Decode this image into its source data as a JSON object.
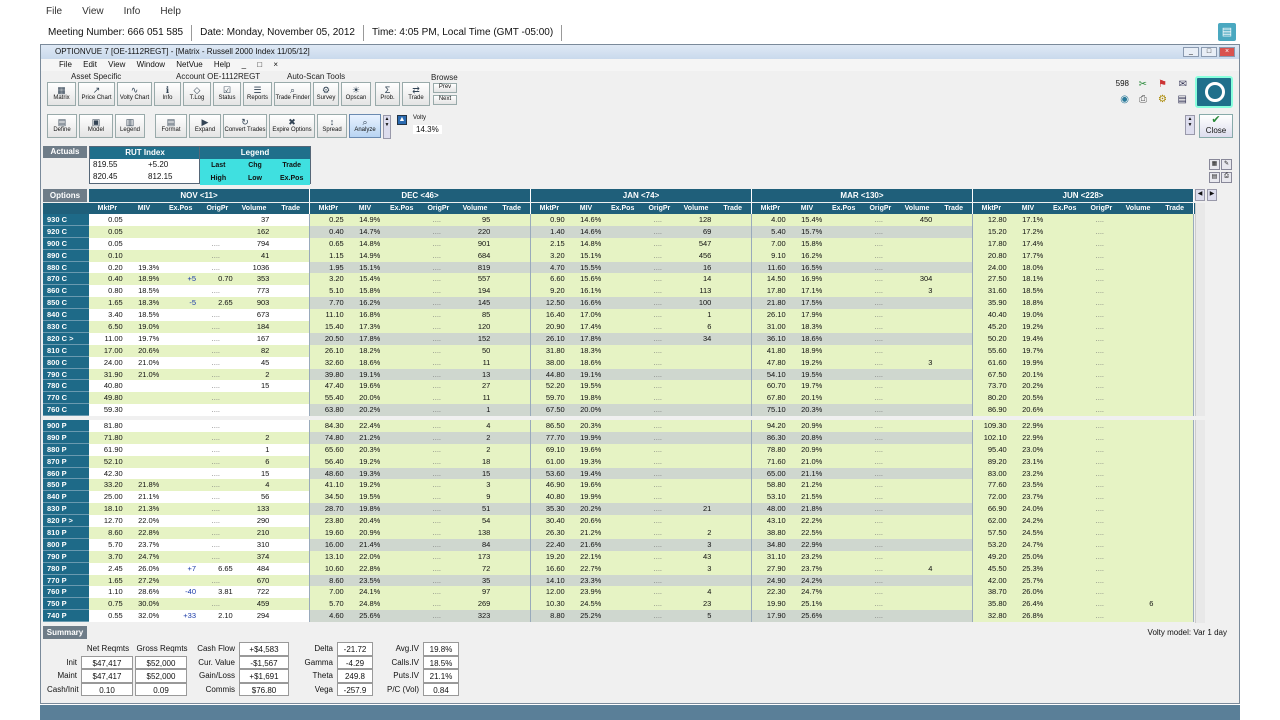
{
  "outer": {
    "menu": [
      "File",
      "View",
      "Info",
      "Help"
    ],
    "meeting": "Meeting Number: 666 051 585",
    "date": "Date: Monday, November 05, 2012",
    "time": "Time: 4:05 PM, Local Time (GMT -05:00)"
  },
  "window": {
    "title": "OPTIONVUE 7  [OE-1112REGT] - [Matrix - Russell 2000 Index 11/05/12]",
    "menu": [
      "File",
      "Edit",
      "View",
      "Window",
      "NetVue",
      "Help",
      "_",
      "□",
      "×"
    ]
  },
  "toolbar": {
    "asset_specific": "Asset Specific",
    "account": "Account OE-1112REGT",
    "auto_scan": "Auto-Scan Tools",
    "browse": "Browse",
    "row1": [
      "Matrix",
      "Price Chart",
      "Volty Chart",
      "Info",
      "T.Log",
      "Status",
      "Reports",
      "Trade Finder",
      "Survey",
      "Opscan",
      "Prob.",
      "Trade"
    ],
    "prev": "Prev",
    "next": "Next",
    "row2": [
      "Define",
      "Model",
      "Legend",
      "Format",
      "Expand",
      "Convert Trades",
      "Expire Options",
      "Spread",
      "Analyze"
    ],
    "volty_label": "Volty",
    "volty_value": "14.3%",
    "count": "598",
    "close": "Close"
  },
  "actuals": {
    "label": "Actuals",
    "rut_title": "RUT Index",
    "r1": [
      "819.55",
      "+5.20"
    ],
    "r2": [
      "820.45",
      "812.15"
    ]
  },
  "legend": {
    "title": "Legend",
    "r1": [
      "Last",
      "Chg",
      "Trade"
    ],
    "r2": [
      "High",
      "Low",
      "Ex.Pos"
    ]
  },
  "options_label": "Options",
  "expirations": [
    "NOV <11>",
    "DEC <46>",
    "JAN <74>",
    "MAR <130>",
    "JUN <228>"
  ],
  "columns": [
    "MktPr",
    "MIV",
    "Ex.Pos",
    "OrigPr",
    "Volume",
    "Trade"
  ],
  "calls": [
    [
      "930 C",
      "0.05",
      "",
      "",
      "",
      "37",
      "",
      "0.25",
      "14.9%",
      "",
      "....",
      "95",
      "",
      "0.90",
      "14.6%",
      "",
      "....",
      "128",
      "",
      "4.00",
      "15.4%",
      "",
      "....",
      "450",
      "",
      "12.80",
      "17.1%",
      "",
      "....",
      "",
      ""
    ],
    [
      "920 C",
      "0.05",
      "",
      "",
      "",
      "162",
      "",
      "0.40",
      "14.7%",
      "",
      "....",
      "220",
      "",
      "1.40",
      "14.6%",
      "",
      "....",
      "69",
      "",
      "5.40",
      "15.7%",
      "",
      "....",
      "",
      "",
      "15.20",
      "17.2%",
      "",
      "....",
      "",
      ""
    ],
    [
      "900 C",
      "0.05",
      "",
      "",
      "....",
      "794",
      "",
      "0.65",
      "14.8%",
      "",
      "....",
      "901",
      "",
      "2.15",
      "14.8%",
      "",
      "....",
      "547",
      "",
      "7.00",
      "15.8%",
      "",
      "....",
      "",
      "",
      "17.80",
      "17.4%",
      "",
      "....",
      "",
      ""
    ],
    [
      "890 C",
      "0.10",
      "",
      "",
      "....",
      "41",
      "",
      "1.15",
      "14.9%",
      "",
      "....",
      "684",
      "",
      "3.20",
      "15.1%",
      "",
      "....",
      "456",
      "",
      "9.10",
      "16.2%",
      "",
      "....",
      "",
      "",
      "20.80",
      "17.7%",
      "",
      "....",
      "",
      ""
    ],
    [
      "880 C",
      "0.20",
      "19.3%",
      "",
      "....",
      "1036",
      "",
      "1.95",
      "15.1%",
      "",
      "....",
      "819",
      "",
      "4.70",
      "15.5%",
      "",
      "....",
      "16",
      "",
      "11.60",
      "16.5%",
      "",
      "....",
      "",
      "",
      "24.00",
      "18.0%",
      "",
      "....",
      "",
      ""
    ],
    [
      "870 C",
      "0.40",
      "18.9%",
      "+5",
      "0.70",
      "353",
      "",
      "3.20",
      "15.4%",
      "",
      "....",
      "557",
      "",
      "6.60",
      "15.6%",
      "",
      "....",
      "14",
      "",
      "14.50",
      "16.9%",
      "",
      "....",
      "304",
      "",
      "27.50",
      "18.1%",
      "",
      "....",
      "",
      ""
    ],
    [
      "860 C",
      "0.80",
      "18.5%",
      "",
      "....",
      "773",
      "",
      "5.10",
      "15.8%",
      "",
      "....",
      "194",
      "",
      "9.20",
      "16.1%",
      "",
      "....",
      "113",
      "",
      "17.80",
      "17.1%",
      "",
      "....",
      "3",
      "",
      "31.60",
      "18.5%",
      "",
      "....",
      "",
      ""
    ],
    [
      "850 C",
      "1.65",
      "18.3%",
      "-5",
      "2.65",
      "903",
      "",
      "7.70",
      "16.2%",
      "",
      "....",
      "145",
      "",
      "12.50",
      "16.6%",
      "",
      "....",
      "100",
      "",
      "21.80",
      "17.5%",
      "",
      "....",
      "",
      "",
      "35.90",
      "18.8%",
      "",
      "....",
      "",
      ""
    ],
    [
      "840 C",
      "3.40",
      "18.5%",
      "",
      "....",
      "673",
      "",
      "11.10",
      "16.8%",
      "",
      "....",
      "85",
      "",
      "16.40",
      "17.0%",
      "",
      "....",
      "1",
      "",
      "26.10",
      "17.9%",
      "",
      "....",
      "",
      "",
      "40.40",
      "19.0%",
      "",
      "....",
      "",
      ""
    ],
    [
      "830 C",
      "6.50",
      "19.0%",
      "",
      "....",
      "184",
      "",
      "15.40",
      "17.3%",
      "",
      "....",
      "120",
      "",
      "20.90",
      "17.4%",
      "",
      "....",
      "6",
      "",
      "31.00",
      "18.3%",
      "",
      "....",
      "",
      "",
      "45.20",
      "19.2%",
      "",
      "....",
      "",
      ""
    ],
    [
      "820 C >",
      "11.00",
      "19.7%",
      "",
      "....",
      "167",
      "",
      "20.50",
      "17.8%",
      "",
      "....",
      "152",
      "",
      "26.10",
      "17.8%",
      "",
      "....",
      "34",
      "",
      "36.10",
      "18.6%",
      "",
      "....",
      "",
      "",
      "50.20",
      "19.4%",
      "",
      "....",
      "",
      ""
    ],
    [
      "810 C",
      "17.00",
      "20.6%",
      "",
      "....",
      "82",
      "",
      "26.10",
      "18.2%",
      "",
      "....",
      "50",
      "",
      "31.80",
      "18.3%",
      "",
      "....",
      "",
      "",
      "41.80",
      "18.9%",
      "",
      "....",
      "",
      "",
      "55.60",
      "19.7%",
      "",
      "....",
      "",
      ""
    ],
    [
      "800 C",
      "24.00",
      "21.0%",
      "",
      "....",
      "45",
      "",
      "32.60",
      "18.6%",
      "",
      "....",
      "11",
      "",
      "38.00",
      "18.6%",
      "",
      "....",
      "",
      "",
      "47.80",
      "19.2%",
      "",
      "....",
      "3",
      "",
      "61.60",
      "19.9%",
      "",
      "....",
      "",
      ""
    ],
    [
      "790 C",
      "31.90",
      "21.0%",
      "",
      "....",
      "2",
      "",
      "39.80",
      "19.1%",
      "",
      "....",
      "13",
      "",
      "44.80",
      "19.1%",
      "",
      "....",
      "",
      "",
      "54.10",
      "19.5%",
      "",
      "....",
      "",
      "",
      "67.50",
      "20.1%",
      "",
      "....",
      "",
      ""
    ],
    [
      "780 C",
      "40.80",
      "",
      "",
      "....",
      "15",
      "",
      "47.40",
      "19.6%",
      "",
      "....",
      "27",
      "",
      "52.20",
      "19.5%",
      "",
      "....",
      "",
      "",
      "60.70",
      "19.7%",
      "",
      "....",
      "",
      "",
      "73.70",
      "20.2%",
      "",
      "....",
      "",
      ""
    ],
    [
      "770 C",
      "49.80",
      "",
      "",
      "....",
      "",
      "",
      "55.40",
      "20.0%",
      "",
      "....",
      "11",
      "",
      "59.70",
      "19.8%",
      "",
      "....",
      "",
      "",
      "67.80",
      "20.1%",
      "",
      "....",
      "",
      "",
      "80.20",
      "20.5%",
      "",
      "....",
      "",
      ""
    ],
    [
      "760 C",
      "59.30",
      "",
      "",
      "....",
      "",
      "",
      "63.80",
      "20.2%",
      "",
      "....",
      "1",
      "",
      "67.50",
      "20.0%",
      "",
      "....",
      "",
      "",
      "75.10",
      "20.3%",
      "",
      "....",
      "",
      "",
      "86.90",
      "20.6%",
      "",
      "....",
      "",
      ""
    ]
  ],
  "puts": [
    [
      "900 P",
      "81.80",
      "",
      "",
      "....",
      "",
      "",
      "84.30",
      "22.4%",
      "",
      "....",
      "4",
      "",
      "86.50",
      "20.3%",
      "",
      "....",
      "",
      "",
      "94.20",
      "20.9%",
      "",
      "....",
      "",
      "",
      "109.30",
      "22.9%",
      "",
      "....",
      "",
      ""
    ],
    [
      "890 P",
      "71.80",
      "",
      "",
      "....",
      "2",
      "",
      "74.80",
      "21.2%",
      "",
      "....",
      "2",
      "",
      "77.70",
      "19.9%",
      "",
      "....",
      "",
      "",
      "86.30",
      "20.8%",
      "",
      "....",
      "",
      "",
      "102.10",
      "22.9%",
      "",
      "....",
      "",
      ""
    ],
    [
      "880 P",
      "61.90",
      "",
      "",
      "....",
      "1",
      "",
      "65.60",
      "20.3%",
      "",
      "....",
      "2",
      "",
      "69.10",
      "19.6%",
      "",
      "....",
      "",
      "",
      "78.80",
      "20.9%",
      "",
      "....",
      "",
      "",
      "95.40",
      "23.0%",
      "",
      "....",
      "",
      ""
    ],
    [
      "870 P",
      "52.10",
      "",
      "",
      "....",
      "6",
      "",
      "56.40",
      "19.2%",
      "",
      "....",
      "18",
      "",
      "61.00",
      "19.3%",
      "",
      "....",
      "",
      "",
      "71.60",
      "21.0%",
      "",
      "....",
      "",
      "",
      "89.20",
      "23.1%",
      "",
      "....",
      "",
      ""
    ],
    [
      "860 P",
      "42.30",
      "",
      "",
      "....",
      "15",
      "",
      "48.60",
      "19.3%",
      "",
      "....",
      "15",
      "",
      "53.60",
      "19.4%",
      "",
      "....",
      "",
      "",
      "65.00",
      "21.1%",
      "",
      "....",
      "",
      "",
      "83.00",
      "23.2%",
      "",
      "....",
      "",
      ""
    ],
    [
      "850 P",
      "33.20",
      "21.8%",
      "",
      "....",
      "4",
      "",
      "41.10",
      "19.2%",
      "",
      "....",
      "3",
      "",
      "46.90",
      "19.6%",
      "",
      "....",
      "",
      "",
      "58.80",
      "21.2%",
      "",
      "....",
      "",
      "",
      "77.60",
      "23.5%",
      "",
      "....",
      "",
      ""
    ],
    [
      "840 P",
      "25.00",
      "21.1%",
      "",
      "....",
      "56",
      "",
      "34.50",
      "19.5%",
      "",
      "....",
      "9",
      "",
      "40.80",
      "19.9%",
      "",
      "....",
      "",
      "",
      "53.10",
      "21.5%",
      "",
      "....",
      "",
      "",
      "72.00",
      "23.7%",
      "",
      "....",
      "",
      ""
    ],
    [
      "830 P",
      "18.10",
      "21.3%",
      "",
      "....",
      "133",
      "",
      "28.70",
      "19.8%",
      "",
      "....",
      "51",
      "",
      "35.30",
      "20.2%",
      "",
      "....",
      "21",
      "",
      "48.00",
      "21.8%",
      "",
      "....",
      "",
      "",
      "66.90",
      "24.0%",
      "",
      "....",
      "",
      ""
    ],
    [
      "820 P >",
      "12.70",
      "22.0%",
      "",
      "....",
      "290",
      "",
      "23.80",
      "20.4%",
      "",
      "....",
      "54",
      "",
      "30.40",
      "20.6%",
      "",
      "....",
      "",
      "",
      "43.10",
      "22.2%",
      "",
      "....",
      "",
      "",
      "62.00",
      "24.2%",
      "",
      "....",
      "",
      ""
    ],
    [
      "810 P",
      "8.60",
      "22.8%",
      "",
      "....",
      "210",
      "",
      "19.60",
      "20.9%",
      "",
      "....",
      "138",
      "",
      "26.30",
      "21.2%",
      "",
      "....",
      "2",
      "",
      "38.80",
      "22.5%",
      "",
      "....",
      "",
      "",
      "57.50",
      "24.5%",
      "",
      "....",
      "",
      ""
    ],
    [
      "800 P",
      "5.70",
      "23.7%",
      "",
      "....",
      "310",
      "",
      "16.00",
      "21.4%",
      "",
      "....",
      "84",
      "",
      "22.40",
      "21.6%",
      "",
      "....",
      "3",
      "",
      "34.80",
      "22.9%",
      "",
      "....",
      "",
      "",
      "53.20",
      "24.7%",
      "",
      "....",
      "",
      ""
    ],
    [
      "790 P",
      "3.70",
      "24.7%",
      "",
      "....",
      "374",
      "",
      "13.10",
      "22.0%",
      "",
      "....",
      "173",
      "",
      "19.20",
      "22.1%",
      "",
      "....",
      "43",
      "",
      "31.10",
      "23.2%",
      "",
      "....",
      "",
      "",
      "49.20",
      "25.0%",
      "",
      "....",
      "",
      ""
    ],
    [
      "780 P",
      "2.45",
      "26.0%",
      "+7",
      "6.65",
      "484",
      "",
      "10.60",
      "22.8%",
      "",
      "....",
      "72",
      "",
      "16.60",
      "22.7%",
      "",
      "....",
      "3",
      "",
      "27.90",
      "23.7%",
      "",
      "....",
      "4",
      "",
      "45.50",
      "25.3%",
      "",
      "....",
      "",
      ""
    ],
    [
      "770 P",
      "1.65",
      "27.2%",
      "",
      "....",
      "670",
      "",
      "8.60",
      "23.5%",
      "",
      "....",
      "35",
      "",
      "14.10",
      "23.3%",
      "",
      "....",
      "",
      "",
      "24.90",
      "24.2%",
      "",
      "....",
      "",
      "",
      "42.00",
      "25.7%",
      "",
      "....",
      "",
      ""
    ],
    [
      "760 P",
      "1.10",
      "28.6%",
      "-40",
      "3.81",
      "722",
      "",
      "7.00",
      "24.1%",
      "",
      "....",
      "97",
      "",
      "12.00",
      "23.9%",
      "",
      "....",
      "4",
      "",
      "22.30",
      "24.7%",
      "",
      "....",
      "",
      "",
      "38.70",
      "26.0%",
      "",
      "....",
      "",
      ""
    ],
    [
      "750 P",
      "0.75",
      "30.0%",
      "",
      "....",
      "459",
      "",
      "5.70",
      "24.8%",
      "",
      "....",
      "269",
      "",
      "10.30",
      "24.5%",
      "",
      "....",
      "23",
      "",
      "19.90",
      "25.1%",
      "",
      "....",
      "",
      "",
      "35.80",
      "26.4%",
      "",
      "....",
      "6",
      ""
    ],
    [
      "740 P",
      "0.55",
      "32.0%",
      "+33",
      "2.10",
      "294",
      "",
      "4.60",
      "25.6%",
      "",
      "....",
      "323",
      "",
      "8.80",
      "25.2%",
      "",
      "....",
      "5",
      "",
      "17.90",
      "25.6%",
      "",
      "....",
      "",
      "",
      "32.80",
      "26.8%",
      "",
      "....",
      "",
      ""
    ]
  ],
  "summary": {
    "label": "Summary",
    "volty_model": "Volty model: Var 1 day",
    "req_headers": [
      "Net Reqmts",
      "Gross Reqmts"
    ],
    "req_rows": [
      [
        "Init",
        "$47,417",
        "$52,000"
      ],
      [
        "Maint",
        "$47,417",
        "$52,000"
      ],
      [
        "Cash/Init",
        "0.10",
        "0.09"
      ]
    ],
    "cash": [
      [
        "Cash Flow",
        "+$4,583"
      ],
      [
        "Cur. Value",
        "-$1,567"
      ],
      [
        "Gain/Loss",
        "+$1,691"
      ],
      [
        "Commis",
        "$76.80"
      ]
    ],
    "greeks": [
      [
        "Delta",
        "-21.72"
      ],
      [
        "Gamma",
        "-4.29"
      ],
      [
        "Theta",
        "249.8"
      ],
      [
        "Vega",
        "-257.9"
      ]
    ],
    "ivs": [
      [
        "Avg.IV",
        "19.8%"
      ],
      [
        "Calls.IV",
        "18.5%"
      ],
      [
        "Puts.IV",
        "21.1%"
      ],
      [
        "P/C (Vol)",
        "0.84"
      ]
    ]
  },
  "colors": {
    "header": "#1f5f7a",
    "green": "#e6f3c4",
    "grey": "#cfd7cf",
    "white": "#ffffff"
  }
}
